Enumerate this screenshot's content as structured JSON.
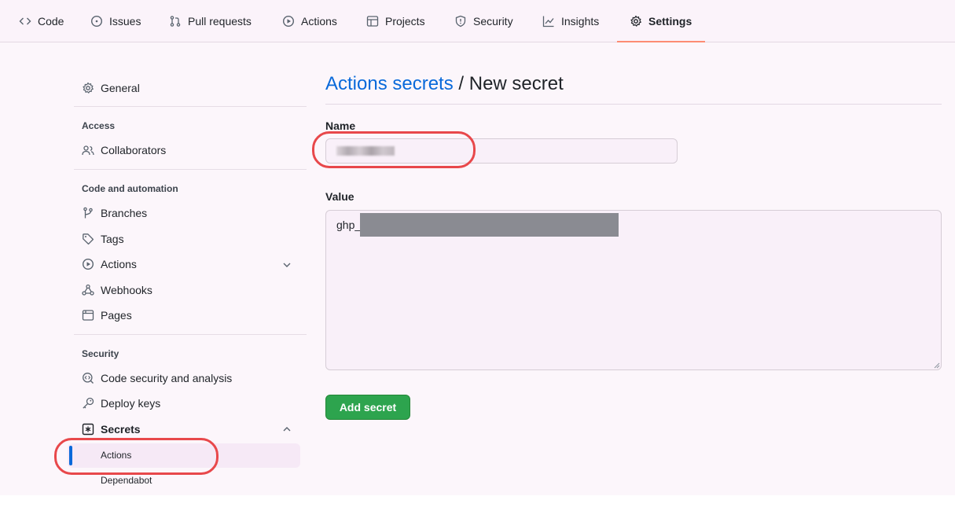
{
  "nav": {
    "tabs": [
      {
        "label": "Code",
        "icon": "code-icon"
      },
      {
        "label": "Issues",
        "icon": "issue-opened-icon"
      },
      {
        "label": "Pull requests",
        "icon": "git-pull-request-icon"
      },
      {
        "label": "Actions",
        "icon": "play-icon"
      },
      {
        "label": "Projects",
        "icon": "table-icon"
      },
      {
        "label": "Security",
        "icon": "shield-icon"
      },
      {
        "label": "Insights",
        "icon": "graph-icon"
      },
      {
        "label": "Settings",
        "icon": "gear-icon",
        "active": true
      }
    ]
  },
  "sidebar": {
    "general": "General",
    "access_heading": "Access",
    "collaborators": "Collaborators",
    "code_automation_heading": "Code and automation",
    "branches": "Branches",
    "tags": "Tags",
    "actions": "Actions",
    "webhooks": "Webhooks",
    "pages": "Pages",
    "security_heading": "Security",
    "code_security": "Code security and analysis",
    "deploy_keys": "Deploy keys",
    "secrets": "Secrets",
    "secrets_sub": [
      {
        "label": "Actions",
        "active": true
      },
      {
        "label": "Dependabot",
        "active": false
      }
    ]
  },
  "main": {
    "breadcrumb_link": "Actions secrets",
    "breadcrumb_sep": " / ",
    "title": "New secret",
    "name_label": "Name",
    "name_value_redacted": true,
    "value_label": "Value",
    "value_prefix": "ghp_",
    "value_redacted": true,
    "submit": "Add secret"
  },
  "colors": {
    "accent_link": "#0969da",
    "primary_button": "#2da44e",
    "active_underline": "#fd8c73",
    "highlight_ring": "#e8484b"
  }
}
